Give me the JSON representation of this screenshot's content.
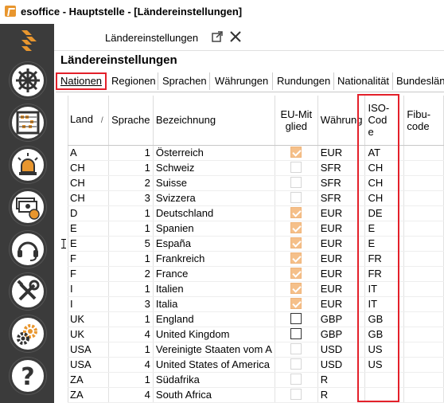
{
  "window": {
    "title": "esoffice - Hauptstelle - [Ländereinstellungen]"
  },
  "sidebar": {
    "items": [
      {
        "name": "helm-icon"
      },
      {
        "name": "abacus-icon"
      },
      {
        "name": "siren-icon"
      },
      {
        "name": "money-icon"
      },
      {
        "name": "headset-icon"
      },
      {
        "name": "tools-icon"
      },
      {
        "name": "gears-icon"
      },
      {
        "name": "help-icon"
      }
    ]
  },
  "panel": {
    "tab_label": "Ländereinstellungen",
    "page_title": "Ländereinstellungen"
  },
  "tabs": [
    "Nationen",
    "Regionen",
    "Sprachen",
    "Währungen",
    "Rundungen",
    "Nationalität",
    "Bundesländer"
  ],
  "grid": {
    "headers": {
      "land": "Land",
      "sort_indicator": "/",
      "sprache": "Sprache",
      "bezeichnung": "Bezeichnung",
      "eu_mitglied": "EU-Mitglied",
      "waehrung": "Währung",
      "iso_code": "ISO-Code",
      "fibu_code": "Fibu-code"
    },
    "rows": [
      {
        "land": "A",
        "sprache": "1",
        "bezeichnung": "Österreich",
        "eu": "on",
        "waehrung": "EUR",
        "iso": "AT",
        "fibu": ""
      },
      {
        "land": "CH",
        "sprache": "1",
        "bezeichnung": "Schweiz",
        "eu": "off",
        "waehrung": "SFR",
        "iso": "CH",
        "fibu": ""
      },
      {
        "land": "CH",
        "sprache": "2",
        "bezeichnung": "Suisse",
        "eu": "off",
        "waehrung": "SFR",
        "iso": "CH",
        "fibu": ""
      },
      {
        "land": "CH",
        "sprache": "3",
        "bezeichnung": "Svizzera",
        "eu": "off",
        "waehrung": "SFR",
        "iso": "CH",
        "fibu": ""
      },
      {
        "land": "D",
        "sprache": "1",
        "bezeichnung": "Deutschland",
        "eu": "on",
        "waehrung": "EUR",
        "iso": "DE",
        "fibu": ""
      },
      {
        "land": "E",
        "sprache": "1",
        "bezeichnung": "Spanien",
        "eu": "on",
        "waehrung": "EUR",
        "iso": "E",
        "fibu": ""
      },
      {
        "land": "E",
        "sprache": "5",
        "bezeichnung": "España",
        "eu": "on",
        "waehrung": "EUR",
        "iso": "E",
        "fibu": ""
      },
      {
        "land": "F",
        "sprache": "1",
        "bezeichnung": "Frankreich",
        "eu": "on",
        "waehrung": "EUR",
        "iso": "FR",
        "fibu": ""
      },
      {
        "land": "F",
        "sprache": "2",
        "bezeichnung": "France",
        "eu": "on",
        "waehrung": "EUR",
        "iso": "FR",
        "fibu": ""
      },
      {
        "land": "I",
        "sprache": "1",
        "bezeichnung": "Italien",
        "eu": "on",
        "waehrung": "EUR",
        "iso": "IT",
        "fibu": ""
      },
      {
        "land": "I",
        "sprache": "3",
        "bezeichnung": "Italia",
        "eu": "on",
        "waehrung": "EUR",
        "iso": "IT",
        "fibu": ""
      },
      {
        "land": "UK",
        "sprache": "1",
        "bezeichnung": "England",
        "eu": "blk",
        "waehrung": "GBP",
        "iso": "GB",
        "fibu": ""
      },
      {
        "land": "UK",
        "sprache": "4",
        "bezeichnung": "United Kingdom",
        "eu": "blk",
        "waehrung": "GBP",
        "iso": "GB",
        "fibu": ""
      },
      {
        "land": "USA",
        "sprache": "1",
        "bezeichnung": "Vereinigte Staaten vom A",
        "eu": "off",
        "waehrung": "USD",
        "iso": "US",
        "fibu": ""
      },
      {
        "land": "USA",
        "sprache": "4",
        "bezeichnung": "United States of America",
        "eu": "off",
        "waehrung": "USD",
        "iso": "US",
        "fibu": ""
      },
      {
        "land": "ZA",
        "sprache": "1",
        "bezeichnung": "Südafrika",
        "eu": "off",
        "waehrung": "R",
        "iso": "",
        "fibu": ""
      },
      {
        "land": "ZA",
        "sprache": "4",
        "bezeichnung": "South Africa",
        "eu": "off",
        "waehrung": "R",
        "iso": "",
        "fibu": ""
      }
    ]
  },
  "colors": {
    "sidebar_bg": "#3b3b3b",
    "accent_orange": "#f5c08a",
    "highlight_red": "#e3202a",
    "brand_orange": "#e8962e"
  }
}
